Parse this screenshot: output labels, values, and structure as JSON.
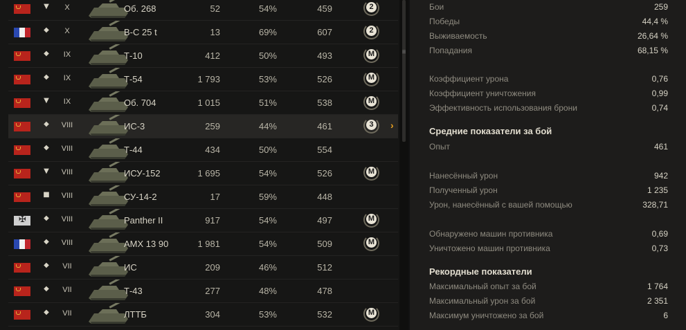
{
  "vehicles": [
    {
      "nation": "ussr",
      "type": "▼",
      "tier": "X",
      "name": "Об. 268",
      "battles": "52",
      "wins": "54%",
      "exp": "459",
      "mark": "2"
    },
    {
      "nation": "france",
      "type": "◆",
      "tier": "X",
      "name": "B-C 25 t",
      "battles": "13",
      "wins": "69%",
      "exp": "607",
      "mark": "2"
    },
    {
      "nation": "ussr",
      "type": "◆",
      "tier": "IX",
      "name": "Т-10",
      "battles": "412",
      "wins": "50%",
      "exp": "493",
      "mark": "M"
    },
    {
      "nation": "ussr",
      "type": "◆",
      "tier": "IX",
      "name": "Т-54",
      "battles": "1 793",
      "wins": "53%",
      "exp": "526",
      "mark": "M"
    },
    {
      "nation": "ussr",
      "type": "▼",
      "tier": "IX",
      "name": "Об. 704",
      "battles": "1 015",
      "wins": "51%",
      "exp": "538",
      "mark": "M"
    },
    {
      "nation": "ussr",
      "type": "◆",
      "tier": "VIII",
      "name": "ИС-3",
      "battles": "259",
      "wins": "44%",
      "exp": "461",
      "mark": "3",
      "selected": true
    },
    {
      "nation": "ussr",
      "type": "◆",
      "tier": "VIII",
      "name": "Т-44",
      "battles": "434",
      "wins": "50%",
      "exp": "554",
      "mark": ""
    },
    {
      "nation": "ussr",
      "type": "▼",
      "tier": "VIII",
      "name": "ИСУ-152",
      "battles": "1 695",
      "wins": "54%",
      "exp": "526",
      "mark": "M"
    },
    {
      "nation": "ussr",
      "type": "■",
      "tier": "VIII",
      "name": "СУ-14-2",
      "battles": "17",
      "wins": "59%",
      "exp": "448",
      "mark": ""
    },
    {
      "nation": "germany",
      "type": "◆",
      "tier": "VIII",
      "name": "Panther II",
      "battles": "917",
      "wins": "54%",
      "exp": "497",
      "mark": "M"
    },
    {
      "nation": "france",
      "type": "◆",
      "tier": "VIII",
      "name": "AMX 13 90",
      "battles": "1 981",
      "wins": "54%",
      "exp": "509",
      "mark": "M"
    },
    {
      "nation": "ussr",
      "type": "◆",
      "tier": "VII",
      "name": "ИС",
      "battles": "209",
      "wins": "46%",
      "exp": "512",
      "mark": ""
    },
    {
      "nation": "ussr",
      "type": "◆",
      "tier": "VII",
      "name": "Т-43",
      "battles": "277",
      "wins": "48%",
      "exp": "478",
      "mark": ""
    },
    {
      "nation": "ussr",
      "type": "◆",
      "tier": "VII",
      "name": "ЛТТБ",
      "battles": "304",
      "wins": "53%",
      "exp": "532",
      "mark": "M"
    }
  ],
  "selected_arrow": "›",
  "scroll_grip": "≡",
  "stats": {
    "general": [
      {
        "label": "Бои",
        "value": "259"
      },
      {
        "label": "Победы",
        "value": "44,4 %"
      },
      {
        "label": "Выживаемость",
        "value": "26,64 %"
      },
      {
        "label": "Попадания",
        "value": "68,15 %"
      }
    ],
    "ratios": [
      {
        "label": "Коэффициент урона",
        "value": "0,76"
      },
      {
        "label": "Коэффициент уничтожения",
        "value": "0,99"
      },
      {
        "label": "Эффективность использования брони",
        "value": "0,74"
      }
    ],
    "average_header": "Средние показатели за бой",
    "average_exp": [
      {
        "label": "Опыт",
        "value": "461"
      }
    ],
    "average_damage": [
      {
        "label": "Нанесённый урон",
        "value": "942"
      },
      {
        "label": "Полученный урон",
        "value": "1 235"
      },
      {
        "label": "Урон, нанесённый с вашей помощью",
        "value": "328,71"
      }
    ],
    "average_spot": [
      {
        "label": "Обнаружено машин противника",
        "value": "0,69"
      },
      {
        "label": "Уничтожено машин противника",
        "value": "0,73"
      }
    ],
    "records_header": "Рекордные показатели",
    "records": [
      {
        "label": "Максимальный опыт за бой",
        "value": "1 764"
      },
      {
        "label": "Максимальный урон за бой",
        "value": "2 351"
      },
      {
        "label": "Максимум уничтожено за бой",
        "value": "6"
      }
    ]
  },
  "colors": {
    "accent": "#e8a020",
    "ussr": "#b8241c"
  }
}
